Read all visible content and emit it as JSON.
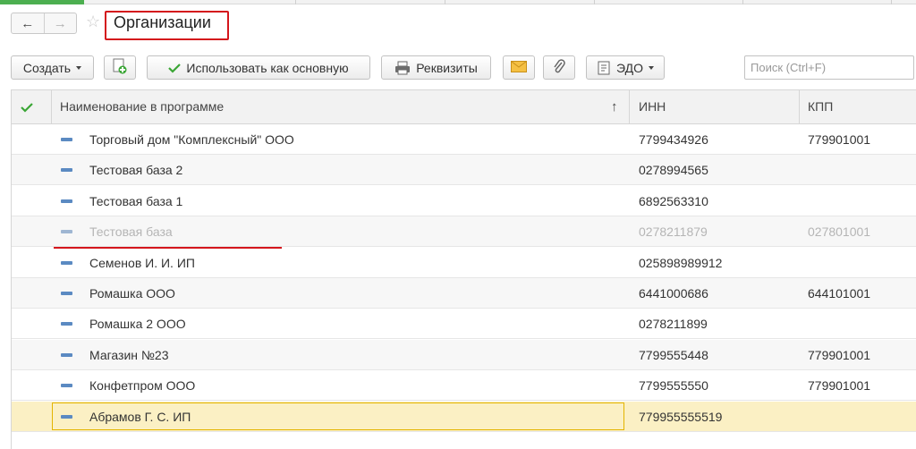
{
  "window": {
    "title": "Организации"
  },
  "nav": {
    "back": "←",
    "forward": "→",
    "star": "☆"
  },
  "toolbar": {
    "create_label": "Создать",
    "use_default_label": "Использовать как основную",
    "requisites_label": "Реквизиты",
    "edo_label": "ЭДО",
    "search_placeholder": "Поиск (Ctrl+F)"
  },
  "table": {
    "columns": [
      "Наименование в программе",
      "ИНН",
      "КПП"
    ],
    "sort_indicator": "↑",
    "rows": [
      {
        "name": "Торговый дом \"Комплексный\" ООО",
        "inn": "7799434926",
        "kpp": "779901001",
        "deleted": false,
        "selected": false
      },
      {
        "name": "Тестовая база 2",
        "inn": "0278994565",
        "kpp": "",
        "deleted": false,
        "selected": false
      },
      {
        "name": "Тестовая база 1",
        "inn": "6892563310",
        "kpp": "",
        "deleted": false,
        "selected": false
      },
      {
        "name": "Тестовая база",
        "inn": "0278211879",
        "kpp": "027801001",
        "deleted": true,
        "selected": false
      },
      {
        "name": "Семенов И. И. ИП",
        "inn": "025898989912",
        "kpp": "",
        "deleted": false,
        "selected": false
      },
      {
        "name": "Ромашка ООО",
        "inn": "6441000686",
        "kpp": "644101001",
        "deleted": false,
        "selected": false
      },
      {
        "name": "Ромашка 2 ООО",
        "inn": "0278211899",
        "kpp": "",
        "deleted": false,
        "selected": false
      },
      {
        "name": "Магазин №23",
        "inn": "7799555448",
        "kpp": "779901001",
        "deleted": false,
        "selected": false
      },
      {
        "name": "Конфетпром ООО",
        "inn": "7799555550",
        "kpp": "779901001",
        "deleted": false,
        "selected": false
      },
      {
        "name": "Абрамов Г. С. ИП",
        "inn": "779955555519",
        "kpp": "",
        "deleted": false,
        "selected": true
      }
    ]
  },
  "colors": {
    "accent": "#4caf50",
    "highlight": "#d4161c",
    "selected_row": "#fbf0c4",
    "row_icon": "#5b8ac2"
  }
}
